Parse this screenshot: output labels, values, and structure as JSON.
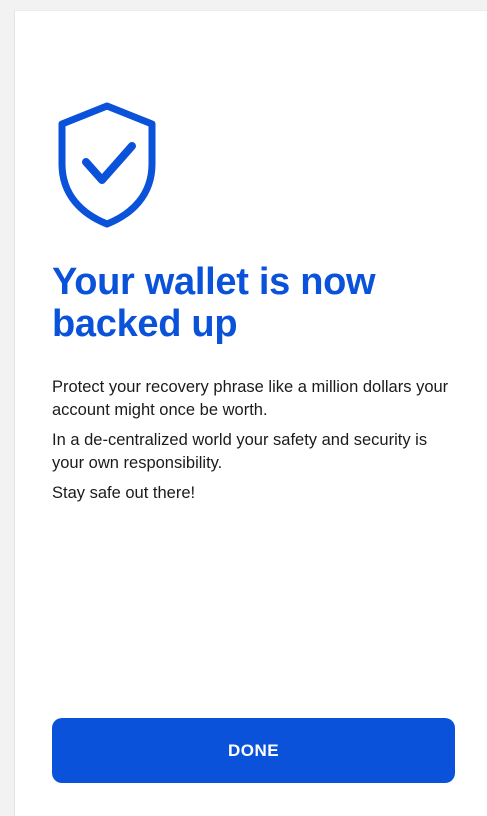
{
  "icon": "shield-check-icon",
  "colors": {
    "accent": "#0a52d9",
    "text": "#1b1b1b",
    "background": "#ffffff"
  },
  "title": "Your wallet is now backed up",
  "paragraphs": [
    "Protect your recovery phrase like a million dollars your account might once be worth.",
    "In a de-centralized world your safety and security is your own responsibility.",
    "Stay safe out there!"
  ],
  "done_button_label": "DONE"
}
